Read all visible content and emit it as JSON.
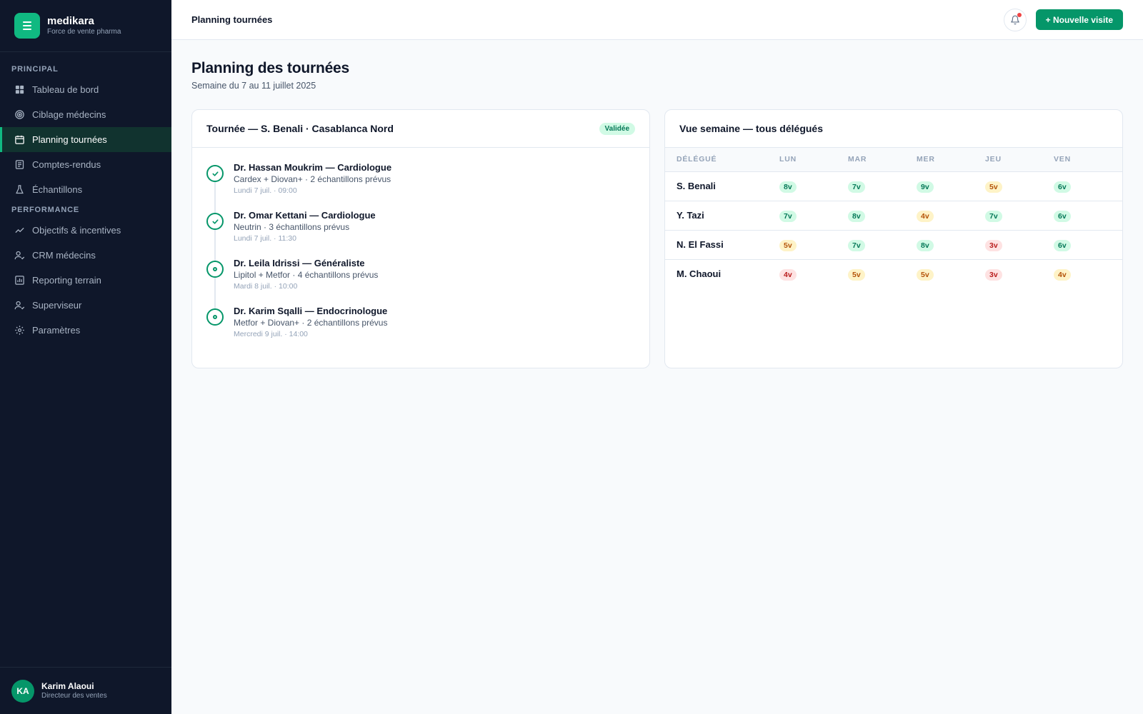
{
  "brand": {
    "name": "medikara",
    "tagline": "Force de vente pharma"
  },
  "sidebar": {
    "sections": [
      {
        "title": "PRINCIPAL",
        "items": [
          {
            "label": "Tableau de bord",
            "icon": "dashboard-icon",
            "active": false
          },
          {
            "label": "Ciblage médecins",
            "icon": "target-icon",
            "active": false
          },
          {
            "label": "Planning tournées",
            "icon": "calendar-icon",
            "active": true
          },
          {
            "label": "Comptes-rendus",
            "icon": "document-icon",
            "active": false
          },
          {
            "label": "Échantillons",
            "icon": "flask-icon",
            "active": false
          }
        ]
      },
      {
        "title": "PERFORMANCE",
        "items": [
          {
            "label": "Objectifs & incentives",
            "icon": "trend-icon",
            "active": false
          },
          {
            "label": "CRM médecins",
            "icon": "user-check-icon",
            "active": false
          },
          {
            "label": "Reporting terrain",
            "icon": "bar-chart-icon",
            "active": false
          },
          {
            "label": "Superviseur",
            "icon": "user-check-icon",
            "active": false
          },
          {
            "label": "Paramètres",
            "icon": "gear-icon",
            "active": false
          }
        ]
      }
    ]
  },
  "user": {
    "initials": "KA",
    "name": "Karim Alaoui",
    "role": "Directeur des ventes"
  },
  "topbar": {
    "title": "Planning tournées",
    "new_visit_label": "+ Nouvelle visite",
    "has_notification": true
  },
  "page": {
    "title": "Planning des tournées",
    "subtitle": "Semaine du 7 au 11 juillet 2025"
  },
  "tour": {
    "title": "Tournée — S. Benali · Casablanca Nord",
    "status": "Validée",
    "visits": [
      {
        "doctor": "Dr. Hassan Moukrim — Cardiologue",
        "detail": "Cardex + Diovan+ · 2 échantillons prévus",
        "time": "Lundi 7 juil. · 09:00",
        "done": true
      },
      {
        "doctor": "Dr. Omar Kettani — Cardiologue",
        "detail": "Neutrin · 3 échantillons prévus",
        "time": "Lundi 7 juil. · 11:30",
        "done": true
      },
      {
        "doctor": "Dr. Leila Idrissi — Généraliste",
        "detail": "Lipitol + Metfor · 4 échantillons prévus",
        "time": "Mardi 8 juil. · 10:00",
        "done": false
      },
      {
        "doctor": "Dr. Karim Sqalli — Endocrinologue",
        "detail": "Metfor + Diovan+ · 2 échantillons prévus",
        "time": "Mercredi 9 juil. · 14:00",
        "done": false
      }
    ]
  },
  "week": {
    "title": "Vue semaine — tous délégués",
    "columns": [
      "DÉLÉGUÉ",
      "LUN",
      "MAR",
      "MER",
      "JEU",
      "VEN"
    ],
    "rows": [
      {
        "name": "S. Benali",
        "cells": [
          {
            "v": "8v",
            "s": "green"
          },
          {
            "v": "7v",
            "s": "green"
          },
          {
            "v": "9v",
            "s": "green"
          },
          {
            "v": "5v",
            "s": "amber"
          },
          {
            "v": "6v",
            "s": "green"
          }
        ]
      },
      {
        "name": "Y. Tazi",
        "cells": [
          {
            "v": "7v",
            "s": "green"
          },
          {
            "v": "8v",
            "s": "green"
          },
          {
            "v": "4v",
            "s": "amber"
          },
          {
            "v": "7v",
            "s": "green"
          },
          {
            "v": "6v",
            "s": "green"
          }
        ]
      },
      {
        "name": "N. El Fassi",
        "cells": [
          {
            "v": "5v",
            "s": "amber"
          },
          {
            "v": "7v",
            "s": "green"
          },
          {
            "v": "8v",
            "s": "green"
          },
          {
            "v": "3v",
            "s": "red"
          },
          {
            "v": "6v",
            "s": "green"
          }
        ]
      },
      {
        "name": "M. Chaoui",
        "cells": [
          {
            "v": "4v",
            "s": "red"
          },
          {
            "v": "5v",
            "s": "amber"
          },
          {
            "v": "5v",
            "s": "amber"
          },
          {
            "v": "3v",
            "s": "red"
          },
          {
            "v": "4v",
            "s": "amber"
          }
        ]
      }
    ]
  },
  "colors": {
    "accent": "#059669",
    "sidebar_bg": "#0f172a",
    "status_green": "#047857",
    "status_amber": "#b45309",
    "status_red": "#b91c1c"
  }
}
